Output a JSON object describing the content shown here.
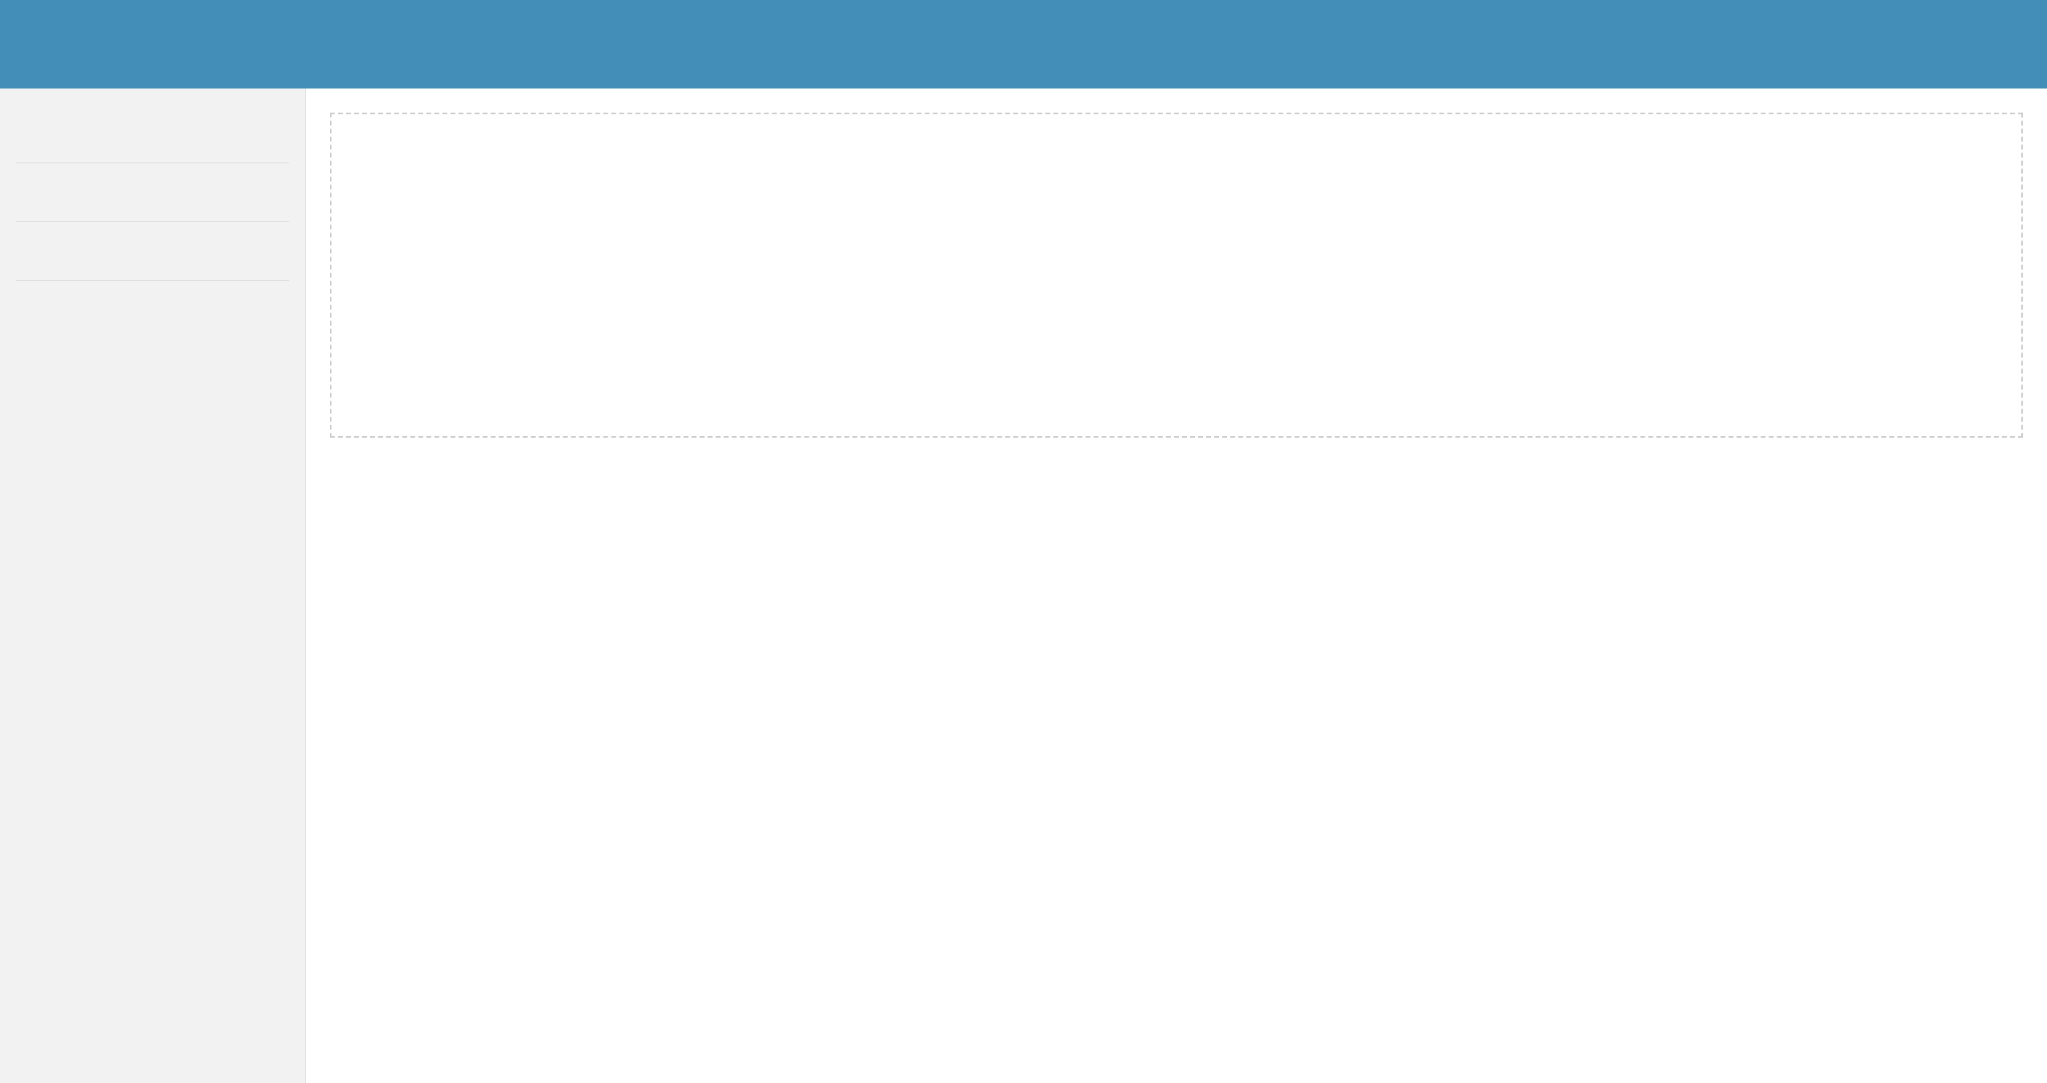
{
  "header": {
    "title": ""
  },
  "sidebar": {
    "items": [
      "",
      "",
      ""
    ]
  },
  "main": {
    "placeholder": ""
  }
}
